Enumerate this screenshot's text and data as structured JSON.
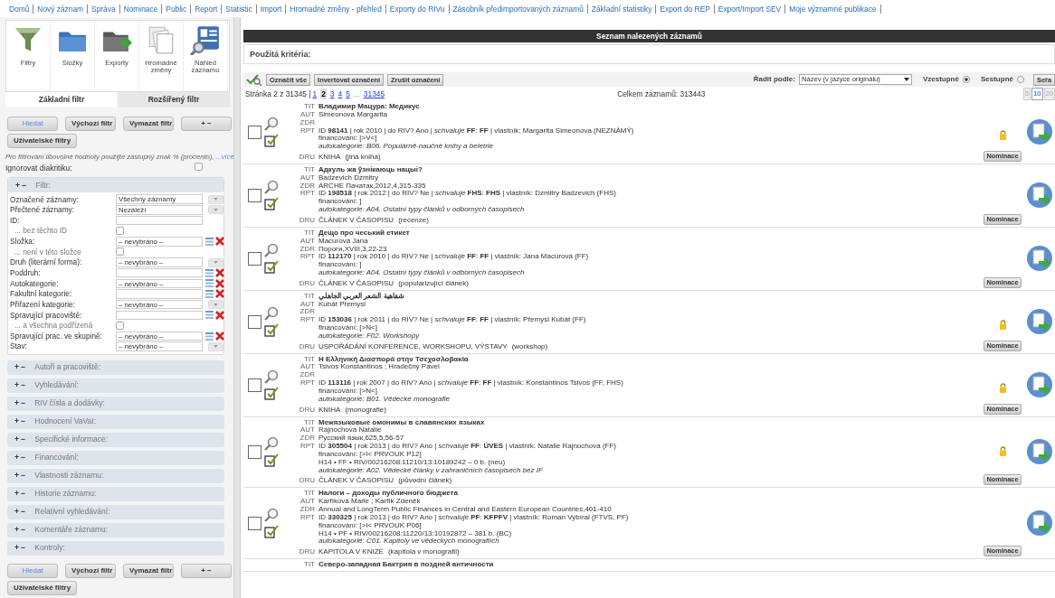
{
  "nav": [
    "Domů",
    "Nový záznam",
    "Správa",
    "Nominace",
    "Public",
    "Report",
    "Statistic",
    "Import",
    "Hromadné změny - přehled",
    "Exporty do RIVu",
    "Zásobník předimportovaných záznamů",
    "Základní statistiky",
    "Export do REP",
    "Export/Import SEV",
    "Moje významné publikace"
  ],
  "left": {
    "tools": [
      {
        "label": "Filtry",
        "kind": "funnel"
      },
      {
        "label": "Složky",
        "kind": "folder"
      },
      {
        "label": "Exporty",
        "kind": "export"
      },
      {
        "label": "Hromadné změny",
        "kind": "documents"
      },
      {
        "label": "Náhled záznamu",
        "kind": "preview"
      }
    ],
    "tabs": [
      {
        "label": "Základní filtr",
        "selected": true
      },
      {
        "label": "Rozšířený filtr",
        "selected": false
      }
    ],
    "top_buttons": {
      "buttons": [
        {
          "label": "Hledat",
          "kind": "primary"
        },
        {
          "label": "Výchozí filtr",
          "kind": "plain"
        },
        {
          "label": "Vymazat filtr",
          "kind": "plain"
        },
        {
          "label": "+ −",
          "kind": "plain"
        }
      ],
      "user": "Uživatelské filtry"
    },
    "hint": {
      "text": "Pro filtrování libovolné hodnoty použijte zástupný znak % (procento),",
      "link": "...více"
    },
    "ignore_diacritics": {
      "label": "Ignorovat diakritiku:",
      "checked": false
    },
    "filter": {
      "toggle": "+ −",
      "title": "Filtr:",
      "expanded": true,
      "fields": [
        {
          "kind": "select",
          "label": "Označené záznamy:",
          "value": "Všechny záznamy"
        },
        {
          "kind": "select",
          "label": "Přečtené záznamy:",
          "value": "Nezáleží"
        },
        {
          "kind": "text",
          "label": "ID:"
        },
        {
          "kind": "checkbox",
          "label": "... bez těchto ID",
          "checked": false
        },
        {
          "kind": "picker",
          "label": "Složka:",
          "value": "– nevybráno –"
        },
        {
          "kind": "checkbox",
          "label": "... není v této složce",
          "checked": false
        },
        {
          "kind": "select",
          "label": "Druh (literární forma):",
          "value": "– nevybráno –"
        },
        {
          "kind": "picker",
          "label": "Poddruh:"
        },
        {
          "kind": "picker",
          "label": "Autokategorie:",
          "value": "– nevybráno –"
        },
        {
          "kind": "picker",
          "label": "Fakultní kategorie:"
        },
        {
          "kind": "select",
          "label": "Přiřazení kategorie:",
          "value": "– nevybráno –"
        },
        {
          "kind": "picker",
          "label": "Spravující pracoviště:"
        },
        {
          "kind": "checkbox",
          "label": "... a všechna podřízená",
          "checked": false
        },
        {
          "kind": "picker",
          "label": "Spravující prac. ve skupině:",
          "value": "– nevybráno –"
        },
        {
          "kind": "select",
          "label": "Stav:",
          "value": "– nevybráno –"
        }
      ]
    },
    "sections": [
      {
        "toggle": "+ −",
        "title": "Autoři a pracoviště:"
      },
      {
        "toggle": "+ −",
        "title": "Vyhledávání:"
      },
      {
        "toggle": "+ −",
        "title": "RIV čísla a dodávky:"
      },
      {
        "toggle": "+ −",
        "title": "Hodnocení VaVaI:"
      },
      {
        "toggle": "+ −",
        "title": "Specifické informace:"
      },
      {
        "toggle": "+ −",
        "title": "Financování:"
      },
      {
        "toggle": "+ −",
        "title": "Vlastnosti záznamu:"
      },
      {
        "toggle": "+ −",
        "title": "Historie záznamu:"
      },
      {
        "toggle": "+ −",
        "title": "Relativní vyhledávání:"
      },
      {
        "toggle": "+ −",
        "title": "Komentáře záznamu:"
      },
      {
        "toggle": "+ −",
        "title": "Kontroly:"
      }
    ],
    "bottom_buttons": {
      "buttons": [
        {
          "label": "Hledat",
          "kind": "primary"
        },
        {
          "label": "Výchozí filtr",
          "kind": "plain"
        },
        {
          "label": "Vymazat filtr",
          "kind": "plain"
        },
        {
          "label": "+ −",
          "kind": "plain"
        }
      ],
      "user": "Uživatelské filtry"
    }
  },
  "results": {
    "title": "Seznam nalezených záznamů",
    "criteria_label": "Použitá kritéria:",
    "toolbar": {
      "buttons": [
        "Označit vše",
        "Invertovat označení",
        "Zrušit označení"
      ],
      "sort_label": "Řadit podle:",
      "sort_value": "Název (v jazyce originálu)",
      "order": [
        {
          "label": "Vzestupně",
          "selected": true
        },
        {
          "label": "Sestupně",
          "selected": false
        }
      ],
      "cut_button": "Seřa"
    },
    "pager": {
      "prefix": "Stránka 2 z 31345 |",
      "pages": [
        {
          "label": "1",
          "selected": false
        },
        {
          "label": "2",
          "selected": true
        },
        {
          "label": "3",
          "selected": false
        },
        {
          "label": "4",
          "selected": false
        },
        {
          "label": "5",
          "selected": false
        },
        {
          "label": "31345",
          "selected": false
        }
      ],
      "ellipsis": "...",
      "total": "Celkem záznamů: 313443",
      "per_page": [
        {
          "label": "5",
          "selected": false
        },
        {
          "label": "10",
          "selected": true
        },
        {
          "label": "20",
          "selected": false
        }
      ]
    },
    "records": [
      {
        "checked": false,
        "locked": true,
        "nominate": "Nominace",
        "lines": [
          {
            "kind": "title",
            "label": "TIT",
            "text": "Владимир Мацура: Медикус"
          },
          {
            "kind": "plain",
            "label": "AUT",
            "text": "Simeonova Margarita"
          },
          {
            "kind": "plain",
            "label": "ZDR"
          },
          {
            "kind": "rich",
            "label": "RPT",
            "text": "ID **98141** | rok 2010 | do RIV? Ano | *schvaluje* **FF**: **FF** | vlastník: Margarita Simeonova (NEZNÁMÝ)"
          },
          {
            "kind": "plain",
            "text": "financování: [>V<]"
          },
          {
            "kind": "italic",
            "text": "autokategorie: B06. Populárně-naučné knihy a beletrie"
          },
          {
            "kind": "type",
            "label": "DRU",
            "text": "KNIHA",
            "note": "(jiná kniha)"
          }
        ]
      },
      {
        "checked": false,
        "locked": false,
        "nominate": "Nominace",
        "lines": [
          {
            "kind": "title",
            "label": "TIT",
            "text": "Адкуль жа ўзнікаюць нацыі?"
          },
          {
            "kind": "plain",
            "label": "AUT",
            "text": "Badzevich Dzmitry"
          },
          {
            "kind": "plain",
            "label": "ZDR",
            "text": "ARCHE Пачатак,2012,4,315-335"
          },
          {
            "kind": "rich",
            "label": "RPT",
            "text": "ID **198518** | rok 2012 | do RIV? Ne | *schvaluje* **FHS**: **FHS** | vlastník: Dzmitry Badzevich (FHS)"
          },
          {
            "kind": "plain",
            "text": "financování: ]"
          },
          {
            "kind": "italic",
            "text": "autokategorie: A04. Ostatní typy článků v odborných časopisech"
          },
          {
            "kind": "type",
            "label": "DRU",
            "text": "ČLÁNEK V ČASOPISU",
            "note": "(recenze)"
          }
        ]
      },
      {
        "checked": false,
        "locked": false,
        "nominate": "Nominace",
        "lines": [
          {
            "kind": "title",
            "label": "TIT",
            "text": "Дещо про чеський етикет"
          },
          {
            "kind": "plain",
            "label": "AUT",
            "text": "Macurová Jana"
          },
          {
            "kind": "plain",
            "label": "ZDR",
            "text": "Пороги,XVIII,3,22-23"
          },
          {
            "kind": "rich",
            "label": "RPT",
            "text": "ID **112170** | rok 2010 | do RIV? Ne | *schvaluje* **FF**: **FF** | vlastník: Jana Macurová (FF)"
          },
          {
            "kind": "plain",
            "text": "financování: ]"
          },
          {
            "kind": "italic",
            "text": "autokategorie: A04. Ostatní typy článků v odborných časopisech"
          },
          {
            "kind": "type",
            "label": "DRU",
            "text": "ČLÁNEK V ČASOPISU",
            "note": "(popularizující článek)"
          }
        ]
      },
      {
        "checked": false,
        "locked": true,
        "nominate": "Nominace",
        "lines": [
          {
            "kind": "title",
            "label": "TIT",
            "text": "شفاهية الشعر العربي الجاهلي"
          },
          {
            "kind": "plain",
            "label": "AUT",
            "text": "Kubát Přemysl"
          },
          {
            "kind": "plain",
            "label": "ZDR"
          },
          {
            "kind": "rich",
            "label": "RPT",
            "text": "ID **153036** | rok 2011 | do RIV? Ne | *schvaluje* **FF**: **FF** | vlastník: Přemysl Kubát (FF)"
          },
          {
            "kind": "plain",
            "text": "financování: [>N<]"
          },
          {
            "kind": "italic",
            "text": "autokategorie: F02. Workshopy"
          },
          {
            "kind": "type",
            "label": "DRU",
            "text": "USPOŘÁDÁNÍ KONFERENCE, WORKSHOPU, VÝSTAVY",
            "note": "(workshop)"
          }
        ]
      },
      {
        "checked": false,
        "locked": true,
        "nominate": "Nominace",
        "lines": [
          {
            "kind": "title",
            "label": "TIT",
            "text": "Η Ελληνική Διασπορά στην Τσεχοσλοβακία"
          },
          {
            "kind": "plain",
            "label": "AUT",
            "text": "Tsivos Konstantinos ;  Hradečný Pavel"
          },
          {
            "kind": "plain",
            "label": "ZDR"
          },
          {
            "kind": "rich",
            "label": "RPT",
            "text": "ID **113116** | rok 2007 | do RIV? Ano | *schvaluje* **FF**: **FF** | vlastník: Konstantinos Tsivos (FF, FHS)"
          },
          {
            "kind": "plain",
            "text": "financování: [>N<]"
          },
          {
            "kind": "italic",
            "text": "autokategorie: B01. Vědecké monografie"
          },
          {
            "kind": "type",
            "label": "DRU",
            "text": "KNIHA",
            "note": "(monografie)"
          }
        ]
      },
      {
        "checked": false,
        "locked": true,
        "nominate": "Nominace",
        "lines": [
          {
            "kind": "title",
            "label": "TIT",
            "text": "Межязыковые омонимы в славянских языках"
          },
          {
            "kind": "plain",
            "label": "AUT",
            "text": "Rajnochová Natalie"
          },
          {
            "kind": "plain",
            "label": "ZDR",
            "text": "Русский язык,625,5,56-57"
          },
          {
            "kind": "rich",
            "label": "RPT",
            "text": "ID **305504** | rok 2013 | do RIV? Ano | *schvaluje* **FF**: **ÚVES** | vlastník: Natalie Rajnochová (FF)"
          },
          {
            "kind": "plain",
            "text": "financování: [>I< PRVOUK P12]"
          },
          {
            "kind": "plain",
            "text": "H14 • FF • RIV/00216208:11210/13:10189242 – 0 b. (neu)"
          },
          {
            "kind": "italic",
            "text": "autokategorie: A02. Vědecké články v zahraničních časopisech bez IF"
          },
          {
            "kind": "type",
            "label": "DRU",
            "text": "ČLÁNEK V ČASOPISU",
            "note": "(původní článek)"
          }
        ]
      },
      {
        "checked": false,
        "locked": false,
        "nominate": "Nominace",
        "lines": [
          {
            "kind": "title",
            "label": "TIT",
            "text": "Налоги – доходы публичного бюджета"
          },
          {
            "kind": "plain",
            "label": "AUT",
            "text": "Karfíková Marie ;  Karfík Zdeněk"
          },
          {
            "kind": "plain",
            "label": "ZDR",
            "text": "Annual and LongTerm Public Finances in Central and Eastern European Countries,401-410"
          },
          {
            "kind": "rich",
            "label": "RPT",
            "text": "ID **330325** | rok 2013 | do RIV? Ano | *schvaluje* **PF**: **KFPFV** | vlastník: Roman Vybíral (FTVS, PF)"
          },
          {
            "kind": "plain",
            "text": "financování: [>I< PRVOUK P06]"
          },
          {
            "kind": "plain",
            "text": "H14 • PF • RIV/00216208:11220/13:10192872 –  381 b. (BC)"
          },
          {
            "kind": "italic",
            "text": "autokategorie: C01. Kapitoly ve vědeckých monografiích"
          },
          {
            "kind": "type",
            "label": "DRU",
            "text": "KAPITOLA V KNIZE",
            "note": "(kapitola v monografii)"
          }
        ]
      },
      {
        "lines": [
          {
            "kind": "title",
            "label": "TIT",
            "text": "Северо-западная Бактрия в поздней античности"
          }
        ]
      }
    ]
  }
}
